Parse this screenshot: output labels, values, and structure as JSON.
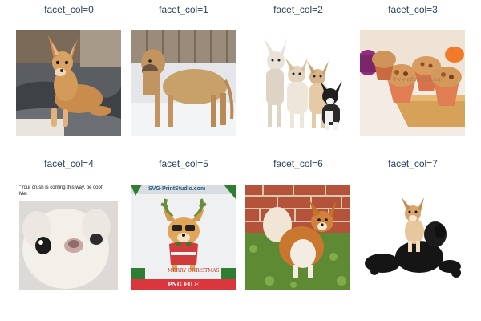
{
  "facets": [
    {
      "title": "facet_col=0",
      "subject": "chihuahua-on-blanket"
    },
    {
      "title": "facet_col=1",
      "subject": "mastiff-in-snow"
    },
    {
      "title": "facet_col=2",
      "subject": "group-of-chihuahuas"
    },
    {
      "title": "facet_col=3",
      "subject": "muffins-on-tray",
      "watermark": "©www.fitmillion.com"
    },
    {
      "title": "facet_col=4",
      "subject": "chihuahua-meme",
      "caption_line1": "\"Your crush is coming this way, be cool\"",
      "caption_line2": "Me:"
    },
    {
      "title": "facet_col=5",
      "subject": "christmas-chihuahua",
      "site_text": "SVG-PrintStudio.com",
      "greeting": "MERRY CHRISTMAS",
      "band": "PNG FILE"
    },
    {
      "title": "facet_col=6",
      "subject": "long-haired-chihuahua-on-grass"
    },
    {
      "title": "facet_col=7",
      "subject": "chihuahua-and-black-poodle"
    }
  ],
  "colors": {
    "title_text": "#2a3f5f",
    "background": "#ffffff"
  }
}
